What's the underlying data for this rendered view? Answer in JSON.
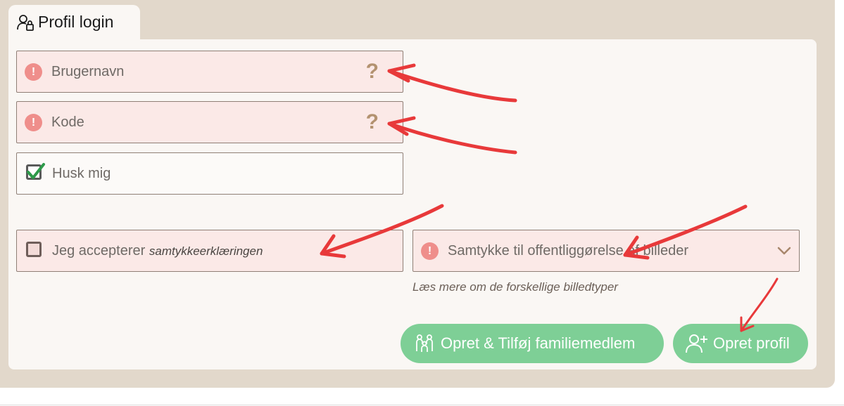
{
  "tab": {
    "title": "Profil login",
    "icon": "user-lock-icon"
  },
  "fields": {
    "username": {
      "placeholder": "Brugernavn",
      "help": "?"
    },
    "password": {
      "placeholder": "Kode",
      "help": "?"
    },
    "remember": {
      "label": "Husk mig",
      "checked": true
    },
    "consent": {
      "label_prefix": "Jeg accepterer ",
      "label_link": "samtykkeerklæringen",
      "checked": false
    },
    "publication": {
      "placeholder": "Samtykke til offentliggørelse af billeder",
      "link": "Læs mere om de forskellige billedtyper"
    }
  },
  "buttons": {
    "add_family": {
      "label": "Opret & Tilføj familiemedlem",
      "icon": "family-icon"
    },
    "create_profile": {
      "label": "Opret profil",
      "icon": "user-plus-icon"
    }
  },
  "colors": {
    "error_bg": "#fbe9e7",
    "error_icon": "#ef8e8b",
    "button": "#7ecf96",
    "annotation_arrow": "#e8393a",
    "page_bg": "#e2d8cb"
  }
}
